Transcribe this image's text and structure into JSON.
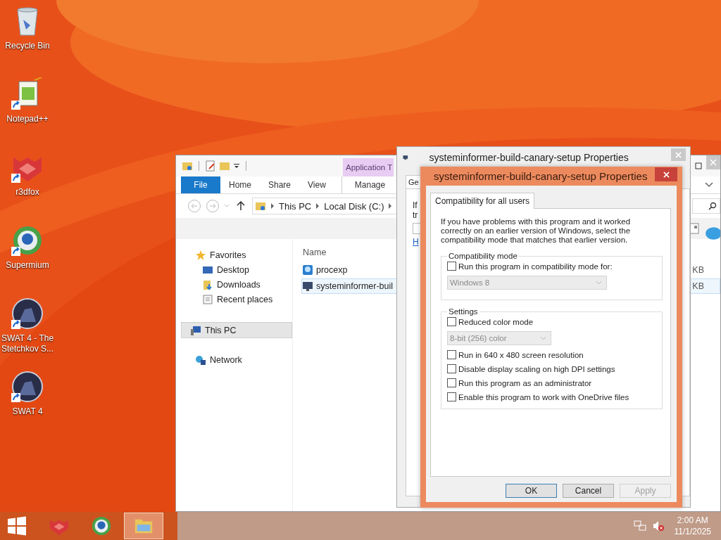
{
  "desktop_icons": [
    {
      "label": "Recycle Bin",
      "kind": "recycle"
    },
    {
      "label": "Notepad++",
      "kind": "notepad"
    },
    {
      "label": "r3dfox",
      "kind": "fox"
    },
    {
      "label": "Supermium",
      "kind": "globe"
    },
    {
      "label": "SWAT 4 - The Stetchkov S...",
      "kind": "swat"
    },
    {
      "label": "SWAT 4",
      "kind": "swat"
    }
  ],
  "explorer": {
    "contextual_tab": "Application T",
    "ribbon_tabs": [
      {
        "label": "File",
        "selected": true
      },
      {
        "label": "Home",
        "selected": false
      },
      {
        "label": "Share",
        "selected": false
      },
      {
        "label": "View",
        "selected": false
      },
      {
        "label": "Manage",
        "selected": false
      }
    ],
    "address": [
      "This PC",
      "Local Disk (C:)"
    ],
    "nav": [
      {
        "label": "Favorites",
        "kind": "star",
        "selected": false,
        "children": [
          {
            "label": "Desktop",
            "kind": "desktop",
            "selected": false
          },
          {
            "label": "Downloads",
            "kind": "downloads",
            "selected": false
          },
          {
            "label": "Recent places",
            "kind": "recent",
            "selected": false
          }
        ]
      },
      {
        "label": "This PC",
        "kind": "pc",
        "selected": true
      },
      {
        "label": "Network",
        "kind": "network",
        "selected": false
      }
    ],
    "column": "Name",
    "files": [
      {
        "name": "procexp",
        "size": "KB",
        "kind": "search",
        "selected": false
      },
      {
        "name": "systeminformer-buil",
        "size": "KB",
        "kind": "monitor",
        "selected": true
      }
    ]
  },
  "back_dialog": {
    "title": "systeminformer-build-canary-setup Properties",
    "tab": "Ge",
    "lines": [
      "If",
      "tr"
    ],
    "link": "H"
  },
  "dialog": {
    "title": "systeminformer-build-canary-setup Properties",
    "tab": "Compatibility for all users",
    "intro": "If you have problems with this program and it worked correctly on an earlier version of Windows, select the compatibility mode that matches that earlier version.",
    "groups": [
      {
        "title": "Compatibility mode",
        "items": [
          {
            "kind": "checkbox",
            "label": "Run this program in compatibility mode for:",
            "checked": false
          },
          {
            "kind": "dropdown",
            "value": "Windows 8",
            "disabled": true
          }
        ]
      },
      {
        "title": "Settings",
        "items": [
          {
            "kind": "checkbox",
            "label": "Reduced color mode",
            "checked": false
          },
          {
            "kind": "dropdown",
            "value": "8-bit (256) color",
            "disabled": true
          },
          {
            "kind": "checkbox",
            "label": "Run in 640 x 480 screen resolution",
            "checked": false
          },
          {
            "kind": "checkbox",
            "label": "Disable display scaling on high DPI settings",
            "checked": false
          },
          {
            "kind": "checkbox",
            "label": "Run this program as an administrator",
            "checked": false
          },
          {
            "kind": "checkbox",
            "label": "Enable this program to work with OneDrive files",
            "checked": false
          }
        ]
      }
    ],
    "buttons": [
      {
        "label": "OK",
        "default": true,
        "disabled": false
      },
      {
        "label": "Cancel",
        "default": false,
        "disabled": false
      },
      {
        "label": "Apply",
        "default": false,
        "disabled": true
      }
    ]
  },
  "taskbar": {
    "apps": [
      {
        "kind": "fox",
        "selected": false
      },
      {
        "kind": "globe",
        "selected": false
      },
      {
        "kind": "folder",
        "selected": true
      }
    ],
    "time": "2:00 AM",
    "date": "11/1/2025"
  }
}
